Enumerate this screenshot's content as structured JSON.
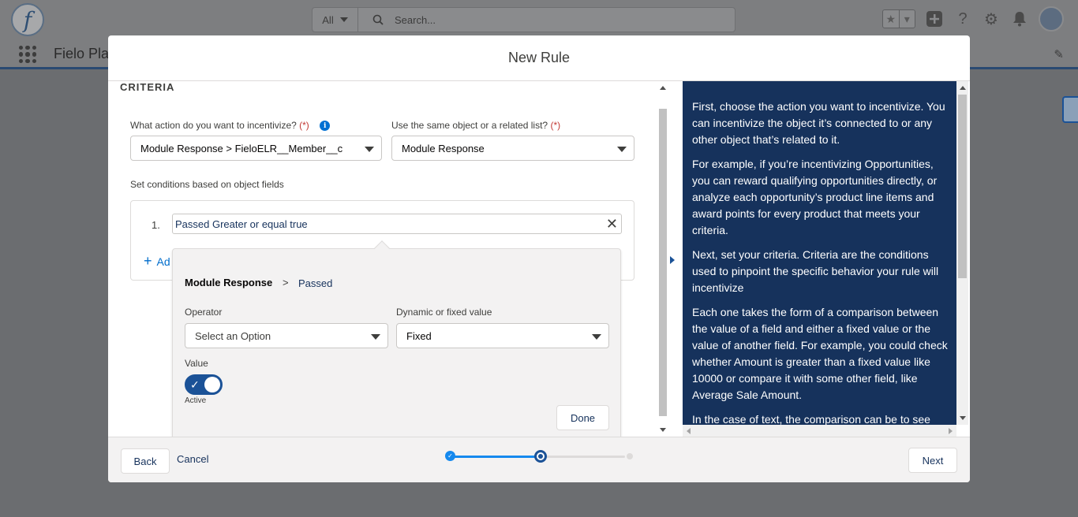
{
  "app": {
    "name": "Fielo Pla",
    "search_scope": "All",
    "search_placeholder": "Search..."
  },
  "modal": {
    "title": "New Rule",
    "section_title": "CRITERIA",
    "action_label": "What action do you want to incentivize?",
    "action_required": "(*)",
    "action_value": "Module Response > FieloELR__Member__c",
    "object_label": "Use the same object or a related list?",
    "object_required": "(*)",
    "object_value": "Module Response",
    "conditions_label": "Set conditions based on object fields",
    "condition": {
      "number": "1.",
      "text": "Passed Greater or equal true",
      "add_label": "Ad"
    },
    "popover": {
      "object": "Module Response",
      "separator": ">",
      "field": "Passed",
      "operator_label": "Operator",
      "operator_placeholder": "Select an Option",
      "value_type_label": "Dynamic or fixed value",
      "value_type": "Fixed",
      "value_label": "Value",
      "toggle_state": "Active",
      "done_label": "Done"
    },
    "help": [
      "First, choose the action you want to incentivize. You can incentivize the object it’s connected to or any other object that’s related to it.",
      "For example, if you’re incentivizing Opportunities, you can reward qualifying opportunities directly, or analyze each opportunity’s product line items and award points for every product that meets your criteria.",
      "Next, set your criteria. Criteria are the conditions used to pinpoint the specific behavior your rule will incentivize",
      "Each one takes the form of a comparison between the value of a field and either a fixed value or the value of another field. For example, you could check whether Amount is greater than a fixed value like 10000 or compare it with some other field, like Average Sale Amount.",
      "In the case of text, the comparison can be to see"
    ],
    "footer": {
      "back_label": "Back",
      "cancel_label": "Cancel",
      "next_label": "Next"
    }
  },
  "colors": {
    "brand_dark": "#16325c",
    "brand_blue": "#1b5297",
    "step_done": "#1589ee"
  }
}
